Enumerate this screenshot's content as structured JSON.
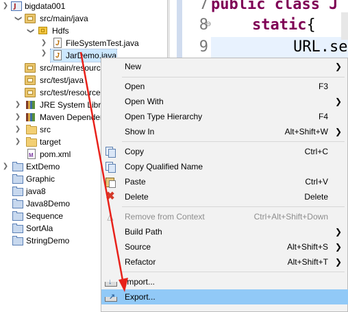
{
  "explorer": {
    "items": [
      {
        "label": "bigdata001",
        "icon": "maven-project-icon",
        "twisty": "expanded"
      },
      {
        "label": "src/main/java",
        "icon": "source-folder-icon",
        "twisty": "expanded"
      },
      {
        "label": "Hdfs",
        "icon": "package-icon",
        "twisty": "expanded"
      },
      {
        "label": "FileSystemTest.java",
        "icon": "java-file-icon",
        "twisty": "collapsed"
      },
      {
        "label": "JarDemo.java",
        "icon": "java-file-icon",
        "twisty": "collapsed",
        "selected": true
      },
      {
        "label": "src/main/resources",
        "icon": "source-folder-icon",
        "twisty": ""
      },
      {
        "label": "src/test/java",
        "icon": "source-folder-icon",
        "twisty": ""
      },
      {
        "label": "src/test/resources",
        "icon": "source-folder-icon",
        "twisty": ""
      },
      {
        "label": "JRE System Library",
        "icon": "library-icon",
        "twisty": "collapsed"
      },
      {
        "label": "Maven Dependencies",
        "icon": "library-icon",
        "twisty": "collapsed"
      },
      {
        "label": "src",
        "icon": "folder-icon",
        "twisty": "collapsed"
      },
      {
        "label": "target",
        "icon": "folder-icon",
        "twisty": "collapsed"
      },
      {
        "label": "pom.xml",
        "icon": "xml-file-icon",
        "twisty": ""
      },
      {
        "label": "ExtDemo",
        "icon": "project-folder-icon",
        "twisty": "collapsed"
      },
      {
        "label": "Graphic",
        "icon": "project-folder-icon",
        "twisty": ""
      },
      {
        "label": "java8",
        "icon": "project-folder-icon",
        "twisty": ""
      },
      {
        "label": "Java8Demo",
        "icon": "project-folder-icon",
        "twisty": ""
      },
      {
        "label": "Sequence",
        "icon": "project-folder-icon",
        "twisty": ""
      },
      {
        "label": "SortAla",
        "icon": "project-folder-icon",
        "twisty": ""
      },
      {
        "label": "StringDemo",
        "icon": "project-folder-icon",
        "twisty": ""
      }
    ]
  },
  "editor": {
    "lines": [
      {
        "number": "7",
        "code_keyword": "public class J",
        "code_rest": ""
      },
      {
        "number": "8",
        "code_keyword": "static",
        "code_rest": "{"
      },
      {
        "number": "9",
        "code_keyword": "",
        "code_rest": "URL.se"
      }
    ]
  },
  "context_menu": {
    "items": [
      {
        "label": "New",
        "shortcut": "",
        "submenu": true
      },
      {
        "label": "Open",
        "shortcut": "F3"
      },
      {
        "label": "Open With",
        "shortcut": "",
        "submenu": true
      },
      {
        "label": "Open Type Hierarchy",
        "shortcut": "F4"
      },
      {
        "label": "Show In",
        "shortcut": "Alt+Shift+W",
        "submenu": true
      },
      {
        "label": "Copy",
        "shortcut": "Ctrl+C",
        "icon": "copy-icon"
      },
      {
        "label": "Copy Qualified Name",
        "shortcut": "",
        "icon": "copy-qualified-name-icon"
      },
      {
        "label": "Paste",
        "shortcut": "Ctrl+V",
        "icon": "paste-icon"
      },
      {
        "label": "Delete",
        "shortcut": "Delete",
        "icon": "delete-icon"
      },
      {
        "label": "Remove from Context",
        "shortcut": "Ctrl+Alt+Shift+Down",
        "disabled": true,
        "icon": "remove-from-context-icon"
      },
      {
        "label": "Build Path",
        "shortcut": "",
        "submenu": true
      },
      {
        "label": "Source",
        "shortcut": "Alt+Shift+S",
        "submenu": true
      },
      {
        "label": "Refactor",
        "shortcut": "Alt+Shift+T",
        "submenu": true
      },
      {
        "label": "Import...",
        "shortcut": "",
        "icon": "import-icon"
      },
      {
        "label": "Export...",
        "shortcut": "",
        "icon": "export-icon",
        "highlighted": true
      }
    ]
  },
  "colors": {
    "annotation_arrow": "#e8211a",
    "menu_highlight": "#91c9f7",
    "selection": "#cce8ff",
    "keyword": "#7f0055"
  }
}
